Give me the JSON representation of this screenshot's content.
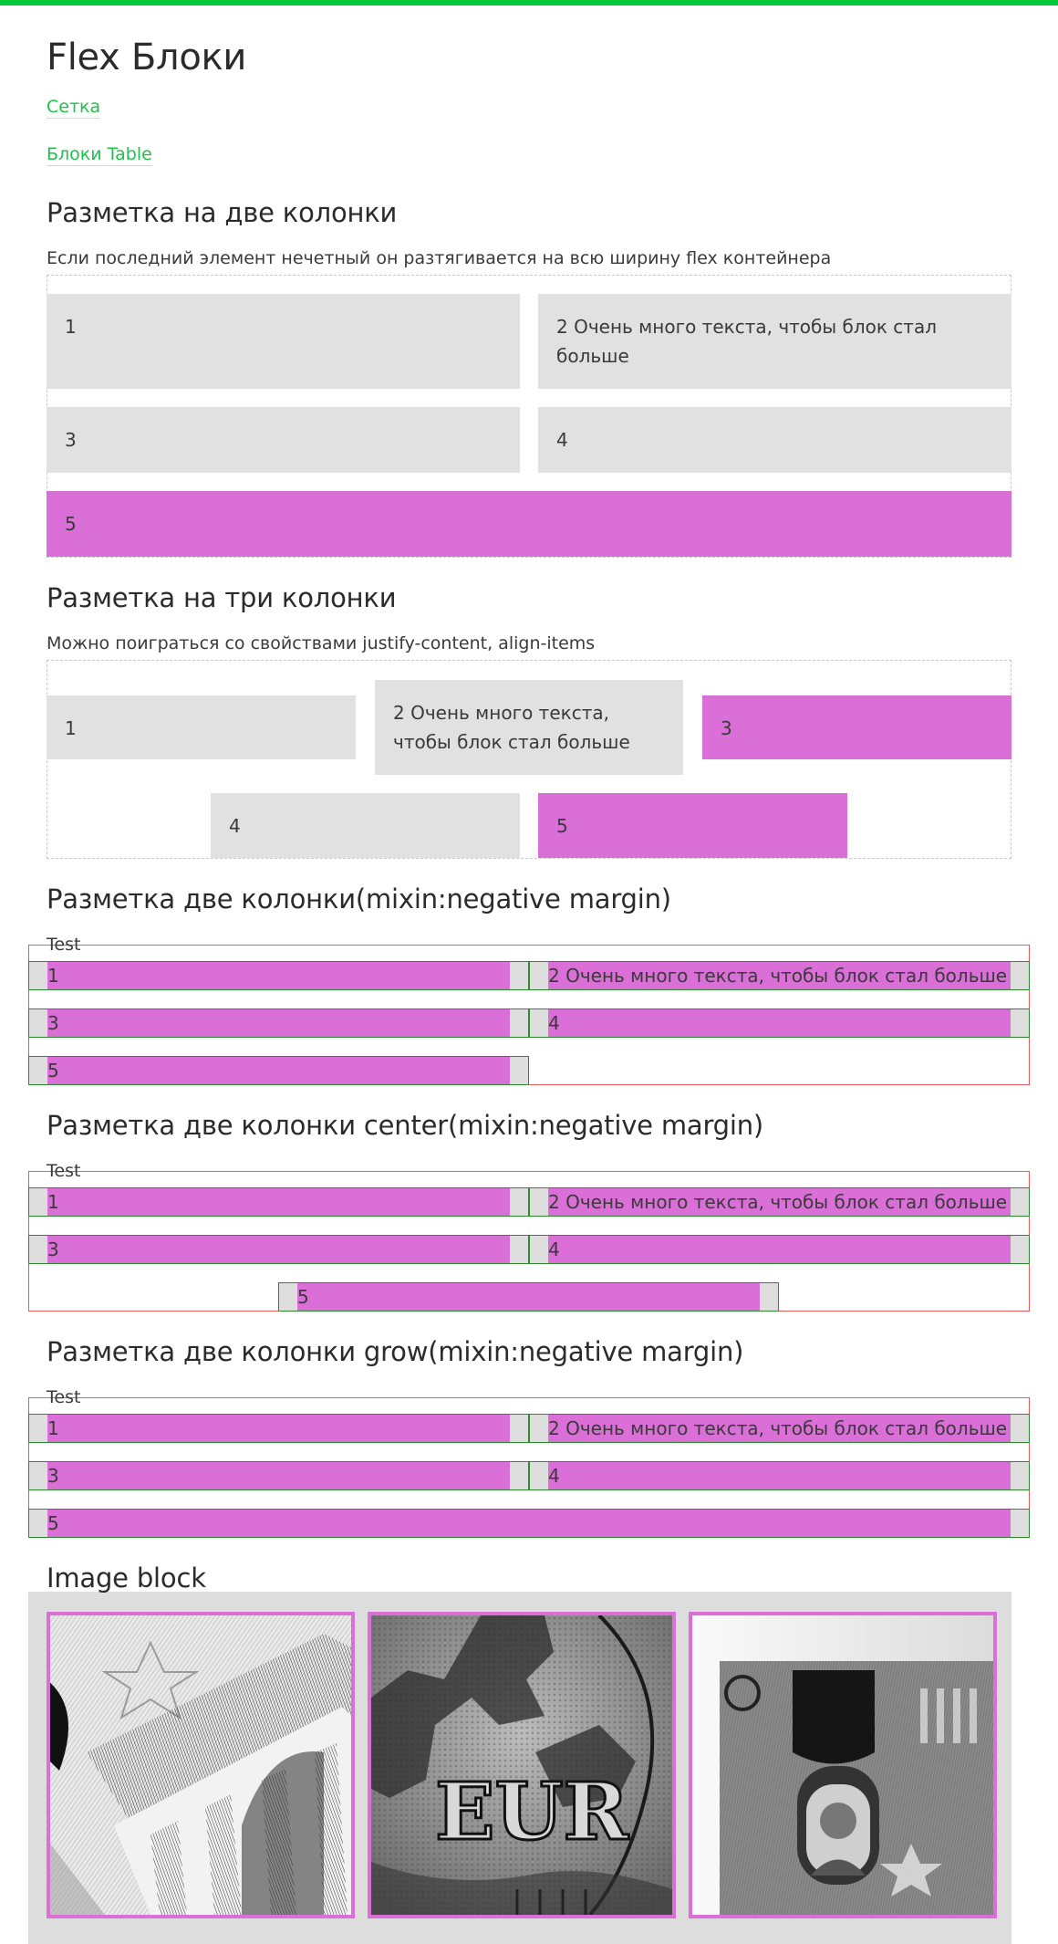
{
  "page": {
    "title": "Flex Блоки",
    "links": [
      "Сетка",
      "Блоки Table"
    ]
  },
  "two_col": {
    "heading": "Разметка на две колонки",
    "desc": "Если последний элемент нечетный он разтягивается на всю ширину flex контейнера",
    "items": [
      "1",
      "2 Очень много текста, чтобы блок стал больше",
      "3",
      "4",
      "5"
    ]
  },
  "three_col": {
    "heading": "Разметка на три колонки",
    "desc": "Можно поиграться со свойствами justify-content, align-items",
    "items": [
      "1",
      "2 Очень много текста, чтобы блок стал больше",
      "3",
      "4",
      "5"
    ]
  },
  "neg_margin": {
    "heading": "Разметка две колонки(mixin:negative margin)",
    "test": "Test",
    "items": [
      "1",
      "2 Очень много текста, чтобы блок стал больше",
      "3",
      "4",
      "5"
    ]
  },
  "neg_center": {
    "heading": "Разметка две колонки center(mixin:negative margin)",
    "test": "Test",
    "items": [
      "1",
      "2 Очень много текста, чтобы блок стал больше",
      "3",
      "4",
      "5"
    ]
  },
  "neg_grow": {
    "heading": "Разметка две колонки grow(mixin:negative margin)",
    "test": "Test",
    "items": [
      "1",
      "2 Очень много текста, чтобы блок стал больше",
      "3",
      "4",
      "5"
    ]
  },
  "image_block": {
    "heading": "Image block",
    "images": [
      {
        "icon": "building-columns-engraving-image"
      },
      {
        "icon": "euro-coin-map-image"
      },
      {
        "icon": "banknote-portrait-image"
      }
    ]
  },
  "colors": {
    "accent": "#00c837",
    "link": "#1fc24a",
    "gray_block": "#e1e1e1",
    "pink_block": "#da6fd8",
    "red_border": "#ea5a5a",
    "green_border": "#2e8a2e"
  }
}
